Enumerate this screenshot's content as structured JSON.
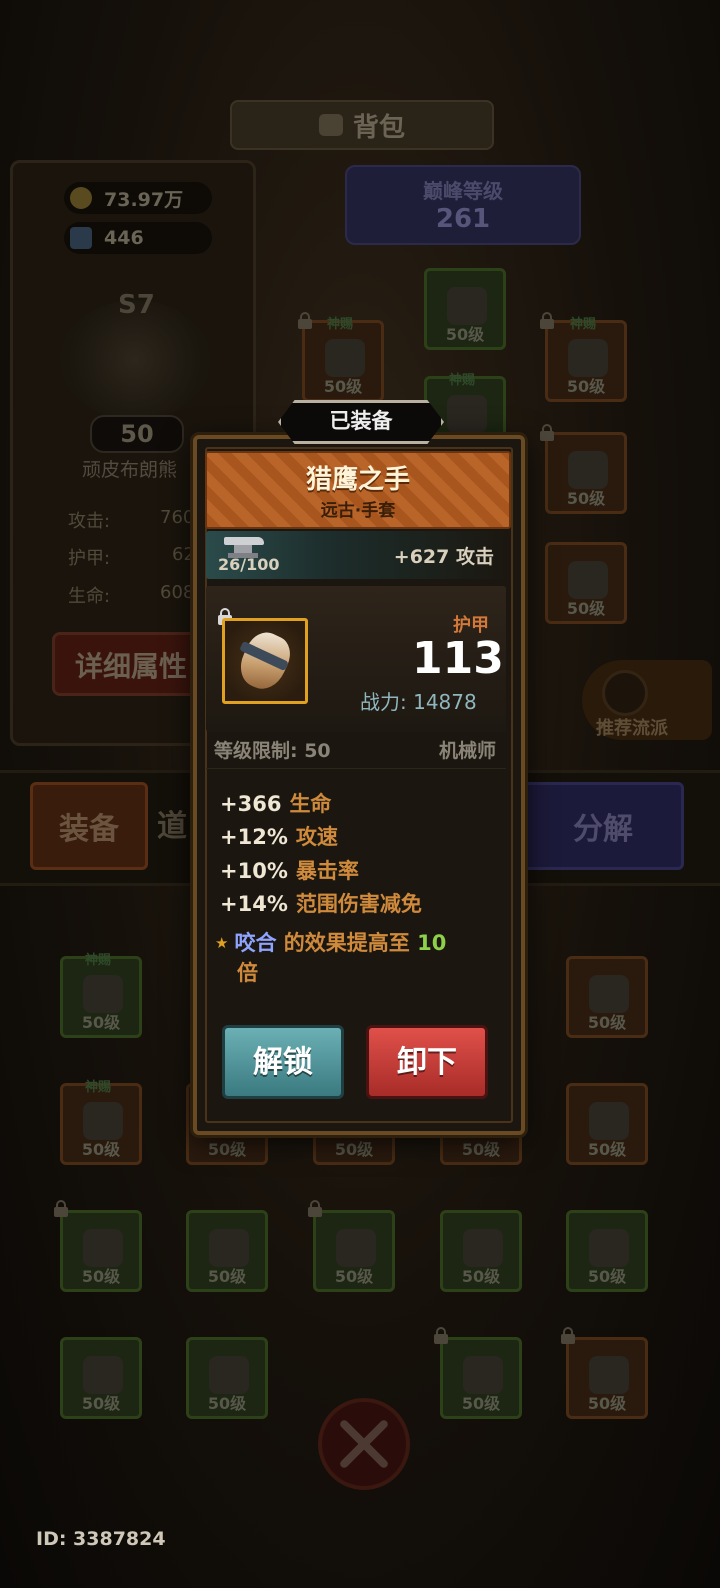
{
  "header": {
    "title": "背包"
  },
  "resources": {
    "gold": "73.97万",
    "gems": "446"
  },
  "hero": {
    "rank": "S7",
    "level": "50",
    "name": "顽皮布朗熊",
    "stats": [
      {
        "label": "攻击:",
        "value": "760"
      },
      {
        "label": "护甲:",
        "value": "62"
      },
      {
        "label": "生命:",
        "value": "608"
      }
    ],
    "detail_button": "详细属性"
  },
  "peak": {
    "label": "巅峰等级",
    "value": "261"
  },
  "equip_slots": [
    {
      "badge": "神赐",
      "level": "50级"
    },
    {
      "badge": "神赐",
      "level": "50级"
    },
    {
      "badge": "神赐",
      "level": "50级"
    },
    {
      "badge": "",
      "level": "50级"
    },
    {
      "badge": "神赐",
      "level": ""
    },
    {
      "badge": "",
      "level": "50级"
    }
  ],
  "recommend": {
    "label": "推荐流派"
  },
  "tabs": {
    "equip": "装备",
    "items": "道",
    "decompose": "分解"
  },
  "inventory": [
    {
      "badge": "神赐",
      "level": "50级"
    },
    {
      "badge": "",
      "level": ""
    },
    {
      "badge": "",
      "level": ""
    },
    {
      "badge": "",
      "level": ""
    },
    {
      "badge": "",
      "level": "50级"
    },
    {
      "badge": "神赐",
      "level": "50级"
    },
    {
      "badge": "",
      "level": "50级"
    },
    {
      "badge": "",
      "level": "50级"
    },
    {
      "badge": "",
      "level": "50级"
    },
    {
      "badge": "",
      "level": "50级"
    },
    {
      "badge": "",
      "level": "50级"
    },
    {
      "badge": "",
      "level": "50级"
    },
    {
      "badge": "",
      "level": "50级"
    },
    {
      "badge": "",
      "level": "50级"
    },
    {
      "badge": "",
      "level": "50级"
    },
    {
      "badge": "",
      "level": "50级"
    },
    {
      "badge": "",
      "level": "50级"
    },
    {
      "badge": "",
      "level": ""
    },
    {
      "badge": "",
      "level": "50级"
    },
    {
      "badge": "",
      "level": "50级"
    }
  ],
  "footer": {
    "uid": "ID: 3387824"
  },
  "dialog": {
    "equipped_tag": "已装备",
    "item_name": "猎鹰之手",
    "item_subtitle": "远古·手套",
    "forge": {
      "progress": "26/100",
      "bonus": "+627 攻击"
    },
    "main_stat_label": "护甲",
    "main_stat_value": "113",
    "power": "战力: 14878",
    "level_req": "等级限制: 50",
    "class": "机械师",
    "attributes": [
      {
        "value": "+366",
        "name": "生命"
      },
      {
        "value": "+12%",
        "name": "攻速"
      },
      {
        "value": "+10%",
        "name": "暴击率"
      },
      {
        "value": "+14%",
        "name": "范围伤害减免"
      }
    ],
    "special": {
      "star": "★",
      "skill": "咬合",
      "text": "的效果提高至",
      "number": "10",
      "unit": "倍"
    },
    "buttons": {
      "unlock": "解锁",
      "unequip": "卸下"
    }
  },
  "colors": {
    "accent_orange": "#d08a3c",
    "skill_blue": "#8ea4ff",
    "number_green": "#8fd04a",
    "unlock_teal": "#3a7a80",
    "unequip_red": "#a82c28"
  }
}
